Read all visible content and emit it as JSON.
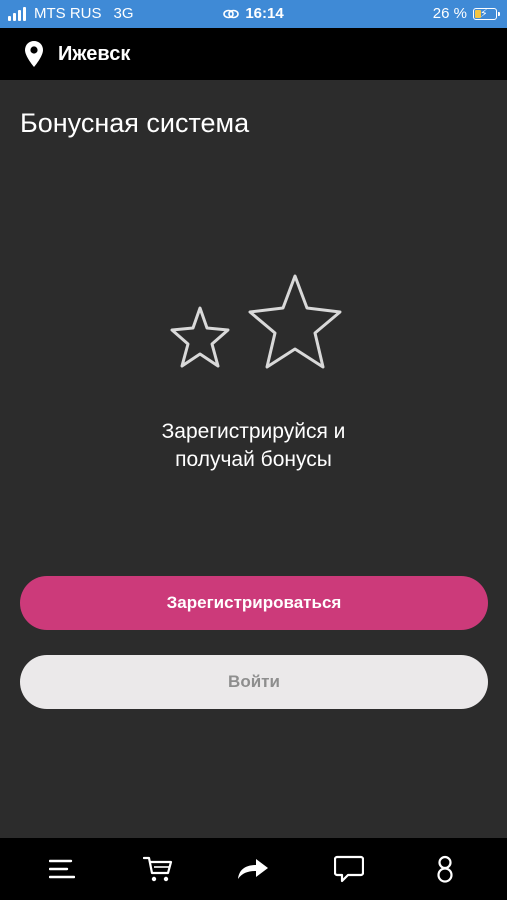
{
  "status_bar": {
    "carrier": "MTS RUS",
    "network": "3G",
    "time": "16:14",
    "battery_percent": "26 %",
    "battery_level": 0.26,
    "background_color": "#3f8ad6"
  },
  "header": {
    "city": "Ижевск",
    "icon": "location-pin-icon"
  },
  "page": {
    "title": "Бонусная система",
    "illustration_icon": "stars-icon",
    "promo_line1": "Зарегистрируйся и",
    "promo_line2": "получай бонусы"
  },
  "buttons": {
    "register_label": "Зарегистрироваться",
    "login_label": "Войти",
    "register_color": "#cc3a7a",
    "login_color": "#ebe9ea"
  },
  "bottom_nav": {
    "items": [
      {
        "icon": "menu-icon"
      },
      {
        "icon": "cart-icon"
      },
      {
        "icon": "share-icon"
      },
      {
        "icon": "chat-icon"
      },
      {
        "icon": "profile-icon"
      }
    ]
  }
}
